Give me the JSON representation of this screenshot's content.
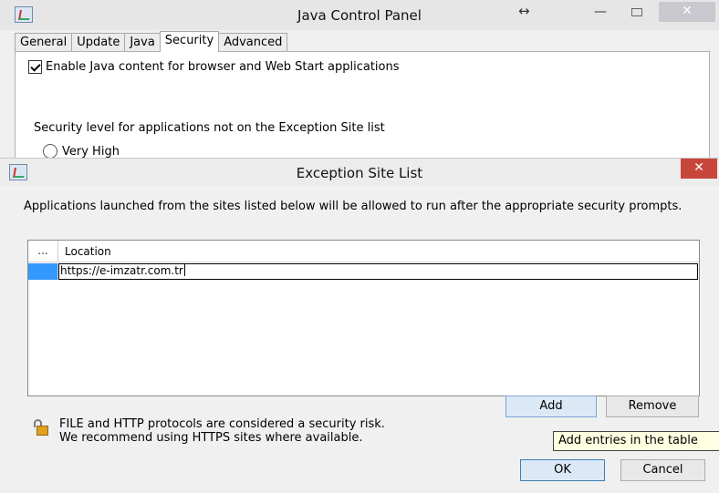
{
  "control_panel": {
    "title": "Java Control Panel",
    "tabs": [
      {
        "label": "General",
        "active": false
      },
      {
        "label": "Update",
        "active": false
      },
      {
        "label": "Java",
        "active": false
      },
      {
        "label": "Security",
        "active": true
      },
      {
        "label": "Advanced",
        "active": false
      }
    ],
    "enable_java_label": "Enable Java content for browser and Web Start applications",
    "enable_java_checked": true,
    "security_level_label": "Security level for applications not on the Exception Site list",
    "radio_very_high_label": "Very High",
    "icons": {
      "app": "java-cup-icon",
      "resize": "resize-arrows-icon",
      "minimize": "minimize-icon",
      "maximize": "maximize-icon",
      "close": "close-icon"
    },
    "window_symbols": {
      "resize": "↔",
      "minimize": "—",
      "close": "✕"
    }
  },
  "exception_dialog": {
    "title": "Exception Site List",
    "description": "Applications launched from the sites listed below will be allowed to run after the appropriate security prompts.",
    "table": {
      "columns": [
        "...",
        "Location"
      ],
      "rows": [
        {
          "location": "https://e-imzatr.com.tr",
          "selected": true,
          "editing": true
        }
      ]
    },
    "add_label": "Add",
    "remove_label": "Remove",
    "warning_line1": "FILE and HTTP protocols are considered a security risk.",
    "warning_line2": "We recommend using HTTPS sites where available.",
    "tooltip": "Add entries in the table",
    "ok_label": "OK",
    "cancel_label": "Cancel",
    "close_symbol": "✕",
    "colors": {
      "selection": "#3399ff",
      "close_button": "#c7463c",
      "tooltip_bg": "#ffffe1"
    }
  }
}
